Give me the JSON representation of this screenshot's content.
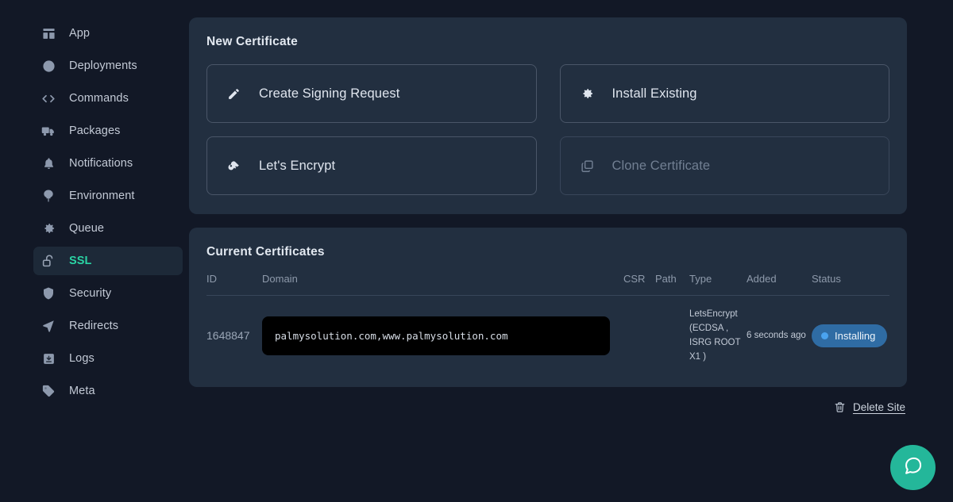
{
  "theme": {
    "page_bg": "#121826",
    "card_bg": "#222f40",
    "accent_teal": "#2ad4a4",
    "badge_blue": "#2f6ca4",
    "badge_dot_blue": "#4aa3ef",
    "chat_bg": "#24b79a"
  },
  "sidebar": {
    "items": [
      {
        "label": "App",
        "icon": "dashboard-icon",
        "active": false
      },
      {
        "label": "Deployments",
        "icon": "clock-icon",
        "active": false
      },
      {
        "label": "Commands",
        "icon": "code-brackets-icon",
        "active": false
      },
      {
        "label": "Packages",
        "icon": "truck-icon",
        "active": false
      },
      {
        "label": "Notifications",
        "icon": "bell-icon",
        "active": false
      },
      {
        "label": "Environment",
        "icon": "tree-icon",
        "active": false
      },
      {
        "label": "Queue",
        "icon": "gear-icon",
        "active": false
      },
      {
        "label": "SSL",
        "icon": "unlock-icon",
        "active": true
      },
      {
        "label": "Security",
        "icon": "shield-icon",
        "active": false
      },
      {
        "label": "Redirects",
        "icon": "navigation-arrow-icon",
        "active": false
      },
      {
        "label": "Logs",
        "icon": "archive-box-icon",
        "active": false
      },
      {
        "label": "Meta",
        "icon": "tag-icon",
        "active": false
      }
    ]
  },
  "new_certificate": {
    "title": "New Certificate",
    "options": [
      {
        "label": "Create Signing Request",
        "icon": "pencil-icon",
        "disabled": false
      },
      {
        "label": "Install Existing",
        "icon": "gear-icon",
        "disabled": false
      },
      {
        "label": "Let's Encrypt",
        "icon": "key-icon",
        "disabled": false
      },
      {
        "label": "Clone Certificate",
        "icon": "copy-icon",
        "disabled": true
      }
    ]
  },
  "current_certificates": {
    "title": "Current Certificates",
    "columns": [
      "ID",
      "Domain",
      "CSR",
      "Path",
      "Type",
      "Added",
      "Status"
    ],
    "rows": [
      {
        "id": "1648847",
        "domain": "palmysolution.com,www.palmysolution.com",
        "csr": "",
        "path": "",
        "type": "LetsEncrypt (ECDSA , ISRG ROOT X1 )",
        "added": "6 seconds ago",
        "status": "Installing"
      }
    ]
  },
  "footer": {
    "delete_label": "Delete Site",
    "delete_icon": "trash-icon"
  },
  "chat": {
    "icon": "chat-bubble-icon"
  }
}
